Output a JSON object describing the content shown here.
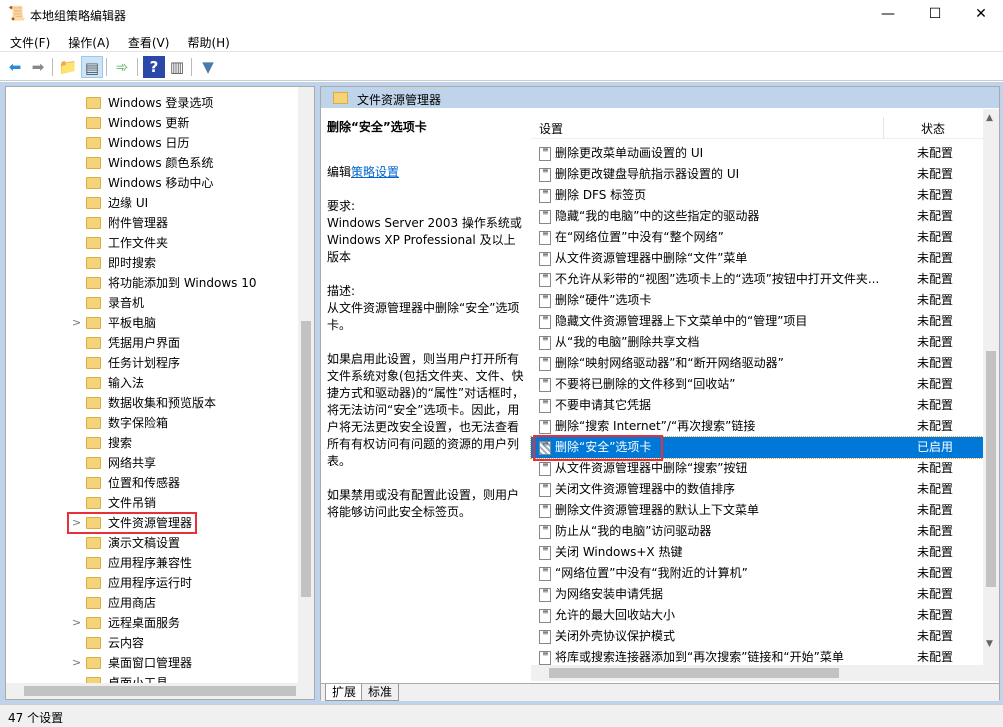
{
  "window": {
    "title": "本地组策略编辑器",
    "minimize": "—",
    "maximize": "☐",
    "close": "✕"
  },
  "menu": [
    "文件(F)",
    "操作(A)",
    "查看(V)",
    "帮助(H)"
  ],
  "toolbar": [
    "back-icon",
    "forward-icon",
    "up-folder-icon",
    "show-hide-tree-icon",
    "export-list-icon",
    "help-icon",
    "show-action-pane-icon",
    "filter-icon"
  ],
  "tree": {
    "items": [
      {
        "label": "Windows 登录选项",
        "expandable": false
      },
      {
        "label": "Windows 更新",
        "expandable": false
      },
      {
        "label": "Windows 日历",
        "expandable": false
      },
      {
        "label": "Windows 颜色系统",
        "expandable": false
      },
      {
        "label": "Windows 移动中心",
        "expandable": false
      },
      {
        "label": "边缘 UI",
        "expandable": false
      },
      {
        "label": "附件管理器",
        "expandable": false
      },
      {
        "label": "工作文件夹",
        "expandable": false
      },
      {
        "label": "即时搜索",
        "expandable": false
      },
      {
        "label": "将功能添加到 Windows 10",
        "expandable": false
      },
      {
        "label": "录音机",
        "expandable": false
      },
      {
        "label": "平板电脑",
        "expandable": true
      },
      {
        "label": "凭据用户界面",
        "expandable": false
      },
      {
        "label": "任务计划程序",
        "expandable": false
      },
      {
        "label": "输入法",
        "expandable": false
      },
      {
        "label": "数据收集和预览版本",
        "expandable": false
      },
      {
        "label": "数字保险箱",
        "expandable": false
      },
      {
        "label": "搜索",
        "expandable": false
      },
      {
        "label": "网络共享",
        "expandable": false
      },
      {
        "label": "位置和传感器",
        "expandable": false
      },
      {
        "label": "文件吊销",
        "expandable": false
      },
      {
        "label": "文件资源管理器",
        "expandable": true,
        "highlighted": true
      },
      {
        "label": "演示文稿设置",
        "expandable": false
      },
      {
        "label": "应用程序兼容性",
        "expandable": false
      },
      {
        "label": "应用程序运行时",
        "expandable": false
      },
      {
        "label": "应用商店",
        "expandable": false
      },
      {
        "label": "远程桌面服务",
        "expandable": true
      },
      {
        "label": "云内容",
        "expandable": false
      },
      {
        "label": "桌面窗口管理器",
        "expandable": true
      },
      {
        "label": "桌面小工具",
        "expandable": false
      }
    ]
  },
  "right": {
    "header": "文件资源管理器",
    "desc": {
      "title": "删除“安全”选项卡",
      "edit_prefix": "编辑",
      "edit_link": "策略设置",
      "req_label": "要求:",
      "req_text": "Windows Server 2003 操作系统或 Windows XP Professional 及以上版本",
      "desc_label": "描述:",
      "desc_text": "从文件资源管理器中删除“安全”选项卡。",
      "p1": "如果启用此设置，则当用户打开所有文件系统对象(包括文件夹、文件、快捷方式和驱动器)的“属性”对话框时，将无法访问“安全”选项卡。因此，用户将无法更改安全设置，也无法查看所有有权访问有问题的资源的用户列表。",
      "p2": "如果禁用或没有配置此设置，则用户将能够访问此安全标签页。"
    },
    "columns": {
      "setting": "设置",
      "state": "状态"
    },
    "rows": [
      {
        "name": "删除更改菜单动画设置的 UI",
        "state": "未配置"
      },
      {
        "name": "删除更改键盘导航指示器设置的 UI",
        "state": "未配置"
      },
      {
        "name": "删除 DFS 标签页",
        "state": "未配置"
      },
      {
        "name": "隐藏“我的电脑”中的这些指定的驱动器",
        "state": "未配置"
      },
      {
        "name": "在“网络位置”中没有“整个网络”",
        "state": "未配置"
      },
      {
        "name": "从文件资源管理器中删除“文件”菜单",
        "state": "未配置"
      },
      {
        "name": "不允许从彩带的“视图”选项卡上的“选项”按钮中打开文件夹...",
        "state": "未配置"
      },
      {
        "name": "删除“硬件”选项卡",
        "state": "未配置"
      },
      {
        "name": "隐藏文件资源管理器上下文菜单中的“管理”项目",
        "state": "未配置"
      },
      {
        "name": "从“我的电脑”删除共享文档",
        "state": "未配置"
      },
      {
        "name": "删除“映射网络驱动器”和“断开网络驱动器”",
        "state": "未配置"
      },
      {
        "name": "不要将已删除的文件移到“回收站”",
        "state": "未配置"
      },
      {
        "name": "不要申请其它凭据",
        "state": "未配置"
      },
      {
        "name": "删除“搜索 Internet”/“再次搜索”链接",
        "state": "未配置"
      },
      {
        "name": "删除“安全”选项卡",
        "state": "已启用",
        "selected": true
      },
      {
        "name": "从文件资源管理器中删除“搜索”按钮",
        "state": "未配置"
      },
      {
        "name": "关闭文件资源管理器中的数值排序",
        "state": "未配置"
      },
      {
        "name": "删除文件资源管理器的默认上下文菜单",
        "state": "未配置"
      },
      {
        "name": "防止从“我的电脑”访问驱动器",
        "state": "未配置"
      },
      {
        "name": "关闭 Windows+X 热键",
        "state": "未配置"
      },
      {
        "name": "“网络位置”中没有“我附近的计算机”",
        "state": "未配置"
      },
      {
        "name": "为网络安装申请凭据",
        "state": "未配置"
      },
      {
        "name": "允许的最大回收站大小",
        "state": "未配置"
      },
      {
        "name": "关闭外壳协议保护模式",
        "state": "未配置"
      },
      {
        "name": "将库或搜索连接器添加到“再次搜索”链接和“开始”菜单",
        "state": "未配置"
      }
    ],
    "tabs": [
      "扩展",
      "标准"
    ],
    "active_tab": "扩展"
  },
  "status": "47 个设置",
  "colors": {
    "selection": "#0078d7",
    "highlight_box": "#e8303a",
    "pane_header": "#bfd3ea",
    "link": "#0066cc"
  }
}
